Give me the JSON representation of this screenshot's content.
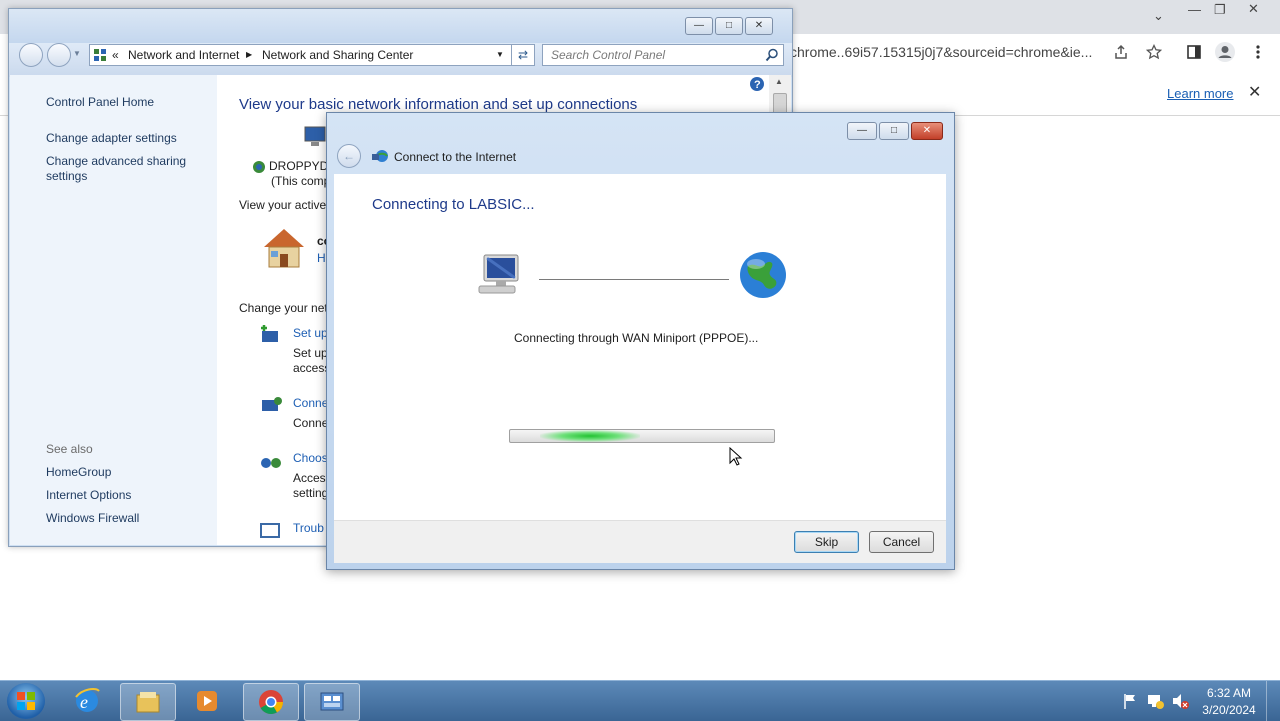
{
  "chrome": {
    "url_text": "chrome..69i57.15315j0j7&sourceid=chrome&ie...",
    "infobar_link": "Learn more",
    "infobar_close": "✕",
    "title_chevron": "⌄",
    "title_min": "—",
    "title_max": "❐",
    "title_close": "✕"
  },
  "control_panel": {
    "breadcrumb": [
      "Network and Internet",
      "Network and Sharing Center"
    ],
    "breadcrumb_prefix": "«",
    "search_placeholder": "Search Control Panel",
    "left_nav": {
      "home": "Control Panel Home",
      "items": [
        "Change adapter settings",
        "Change advanced sharing settings"
      ],
      "see_also_label": "See also",
      "see_also": [
        "HomeGroup",
        "Internet Options",
        "Windows Firewall"
      ]
    },
    "main": {
      "heading": "View your basic network information and set up connections",
      "computer_name": "DROPPYDI",
      "computer_sub": "(This comp",
      "active_label": "View your active",
      "network_name": "co",
      "network_sub": "H",
      "change_label": "Change your net",
      "tasks": [
        {
          "title": "Set up",
          "desc1": "Set up",
          "desc2": "access"
        },
        {
          "title": "Conne",
          "desc1": "Conne",
          "desc2": ""
        },
        {
          "title": "Choos",
          "desc1": "Acces",
          "desc2": "setting"
        },
        {
          "title": "Troub",
          "desc1": "",
          "desc2": ""
        }
      ]
    }
  },
  "dialog": {
    "title": "Connect to the Internet",
    "heading": "Connecting to LABSIC...",
    "status": "Connecting through WAN Miniport (PPPOE)...",
    "skip_label": "Skip",
    "cancel_label": "Cancel"
  },
  "taskbar": {
    "time": "6:32 AM",
    "date": "3/20/2024",
    "pinned": [
      "start-orb",
      "internet-explorer-icon",
      "file-explorer-icon",
      "media-player-icon",
      "chrome-icon",
      "control-panel-icon"
    ]
  },
  "colors": {
    "link_blue": "#1e5fb4",
    "dialog_heading": "#1e3a8a",
    "progress_green": "#22c232"
  }
}
